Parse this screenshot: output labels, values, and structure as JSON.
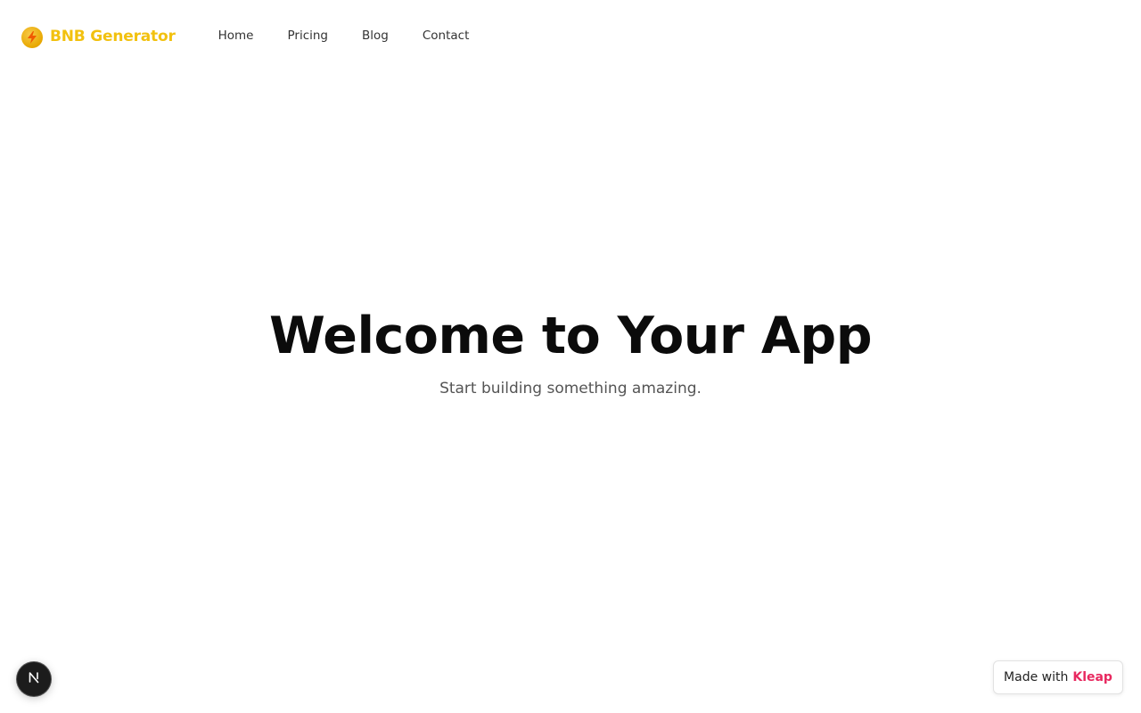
{
  "brand": {
    "name": "BNB Generator",
    "icon": "lightning-bolt-icon",
    "color": "#f2c10f"
  },
  "nav": {
    "links": [
      {
        "label": "Home"
      },
      {
        "label": "Pricing"
      },
      {
        "label": "Blog"
      },
      {
        "label": "Contact"
      }
    ]
  },
  "hero": {
    "title": "Welcome to Your App",
    "subtitle": "Start building something amazing."
  },
  "dev_badge": {
    "icon": "nextjs-n-icon"
  },
  "made_with": {
    "prefix": "Made with",
    "brand": "Kleap",
    "brand_color": "#e8285f"
  }
}
